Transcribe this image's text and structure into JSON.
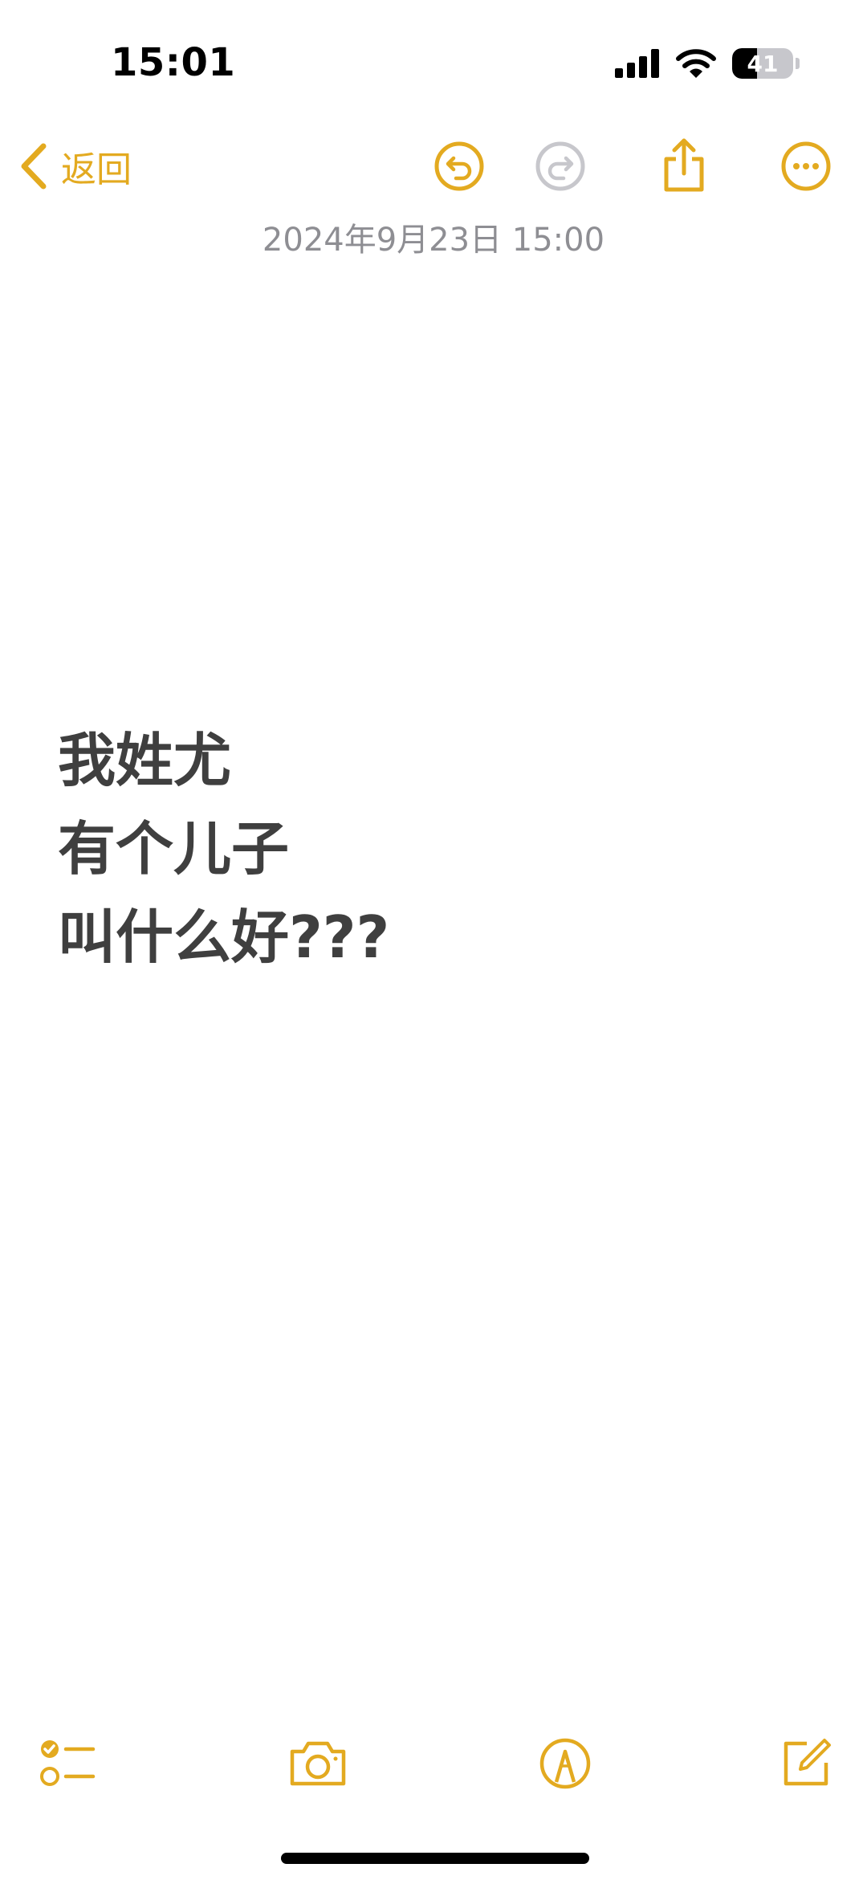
{
  "status_bar": {
    "time": "15:01",
    "battery_level": "41",
    "battery_fraction": 0.41
  },
  "nav": {
    "back_label": "返回",
    "icons": [
      "chevron-left-icon",
      "undo-icon",
      "redo-icon",
      "share-icon",
      "more-icon"
    ]
  },
  "note": {
    "date": "2024年9月23日 15:00",
    "lines": [
      "我姓尤",
      "有个儿子",
      "叫什么好???"
    ]
  },
  "toolbar": {
    "icons": [
      "checklist-icon",
      "camera-icon",
      "markup-icon",
      "compose-icon"
    ]
  },
  "colors": {
    "accent": "#E3AA20",
    "disabled": "#C7C7CC",
    "body_text": "#3F3F3F",
    "date_text": "#8E8E93"
  }
}
